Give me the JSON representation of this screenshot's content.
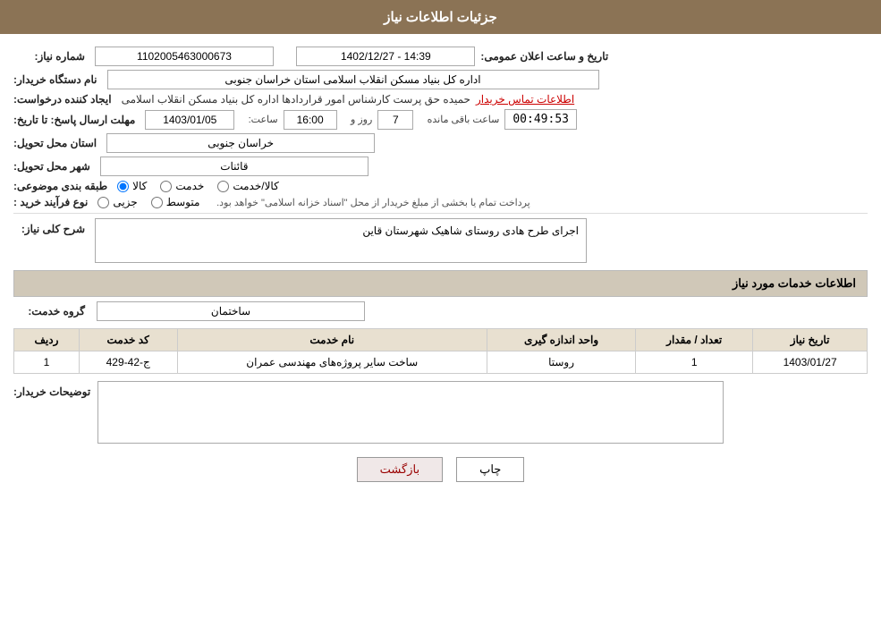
{
  "header": {
    "title": "جزئیات اطلاعات نیاز"
  },
  "fields": {
    "need_number_label": "شماره نیاز:",
    "need_number_value": "1102005463000673",
    "announce_datetime_label": "تاریخ و ساعت اعلان عمومی:",
    "announce_datetime_value": "1402/12/27 - 14:39",
    "buyer_org_label": "نام دستگاه خریدار:",
    "buyer_org_value": "اداره کل بنیاد مسکن انقلاب اسلامی استان خراسان جنوبی",
    "creator_label": "ایجاد کننده درخواست:",
    "creator_value": "حمیده حق پرست کارشناس امور قراردادها اداره کل بنیاد مسکن انقلاب اسلامی",
    "contact_link": "اطلاعات تماس خریدار",
    "deadline_label": "مهلت ارسال پاسخ: تا تاریخ:",
    "deadline_date": "1403/01/05",
    "deadline_time_label": "ساعت:",
    "deadline_time": "16:00",
    "deadline_day_label": "روز و",
    "deadline_days": "7",
    "remaining_label": "ساعت باقی مانده",
    "remaining_time": "00:49:53",
    "province_label": "استان محل تحویل:",
    "province_value": "خراسان جنوبی",
    "city_label": "شهر محل تحویل:",
    "city_value": "قائنات",
    "category_label": "طبقه بندی موضوعی:",
    "category_radio1": "کالا",
    "category_radio2": "خدمت",
    "category_radio3": "کالا/خدمت",
    "process_label": "نوع فرآیند خرید :",
    "process_note": "پرداخت تمام یا بخشی از مبلغ خریدار از محل \"اسناد خزانه اسلامی\" خواهد بود.",
    "process_radio1": "جزیی",
    "process_radio2": "متوسط",
    "description_label": "شرح کلی نیاز:",
    "description_value": "اجرای طرح هادی روستای شاهیک شهرستان قاین",
    "services_section_label": "اطلاعات خدمات مورد نیاز",
    "service_group_label": "گروه خدمت:",
    "service_group_value": "ساختمان",
    "table_headers": {
      "row_num": "ردیف",
      "service_code": "کد خدمت",
      "service_name": "نام خدمت",
      "unit": "واحد اندازه گیری",
      "quantity": "تعداد / مقدار",
      "date": "تاریخ نیاز"
    },
    "table_rows": [
      {
        "row": "1",
        "code": "ج-42-429",
        "name": "ساخت سایر پروژه‌های مهندسی عمران",
        "unit": "روستا",
        "quantity": "1",
        "date": "1403/01/27"
      }
    ],
    "buyer_desc_label": "توضیحات خریدار:"
  },
  "buttons": {
    "print": "چاپ",
    "back": "بازگشت"
  }
}
